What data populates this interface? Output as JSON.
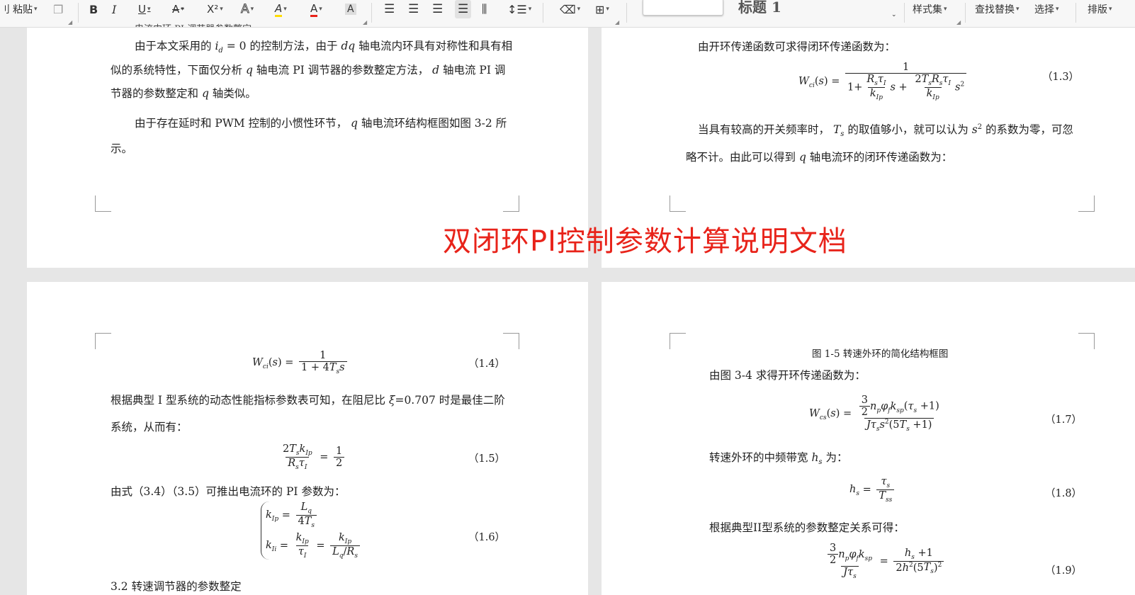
{
  "toolbar": {
    "paste": "粘贴",
    "bold": "B",
    "italic": "I",
    "underline": "U",
    "strike": "A",
    "superscript": "X²",
    "text_effect": "A",
    "highlight": "A",
    "font_color": "A",
    "char_shade": "A",
    "style_preview": "标题 1",
    "style_set": "样式集",
    "find_replace": "查找替换",
    "select": "选择",
    "layout": "排版",
    "icons": [
      "align-left-icon",
      "align-center-icon",
      "align-right-icon",
      "justify-icon",
      "distributed-icon",
      "line-spacing-icon",
      "clear-format-icon",
      "border-icon"
    ]
  },
  "banner": "双闭环PI控制参数计算说明文档",
  "page1": {
    "p1": [
      "由于本文采用的 i_d = 0 的控制方法，由于 dq 轴电流内环具有对称性和具有相",
      "似的系统特性，下面仅分析 q 轴电流 PI 调节器的参数整定方法， d 轴电流 PI 调",
      "节器的参数整定和 q 轴类似。"
    ],
    "p2": [
      "由于存在延时和 PWM 控制的小惯性环节， q 轴电流环结构框图如图 3-2 所",
      "示。"
    ]
  },
  "page2": {
    "p1": "由开环传递函数可求得闭环传递函数为：",
    "eq13_num": "（1.3）",
    "p2": [
      "当具有较高的开关频率时， T_s 的取值够小，就可以认为 s² 的系数为零，可忽",
      "略不计。由此可以得到 q 轴电流环的闭环传递函数为："
    ]
  },
  "page3": {
    "eq14_num": "（1.4）",
    "p1": [
      "根据典型 I 型系统的动态性能指标参数表可知，在阻尼比 ξ=0.707 时是最佳二阶",
      "系统，从而有："
    ],
    "eq15_num": "（1.5）",
    "p2": "由式（3.4）（3.5）可推出电流环的 PI 参数为：",
    "eq16_num": "（1.6）",
    "p3": "3.2   转速调节器的参数整定"
  },
  "page4": {
    "caption": "图 1-5  转速外环的简化结构框图",
    "p1": "由图 3-4 求得开环传递函数为：",
    "eq17_num": "（1.7）",
    "p2": "转速外环的中频带宽 h_s 为：",
    "eq18_num": "（1.8）",
    "p3": "根据典型II型系统的参数整定关系可得：",
    "eq19_num": "（1.9）"
  }
}
